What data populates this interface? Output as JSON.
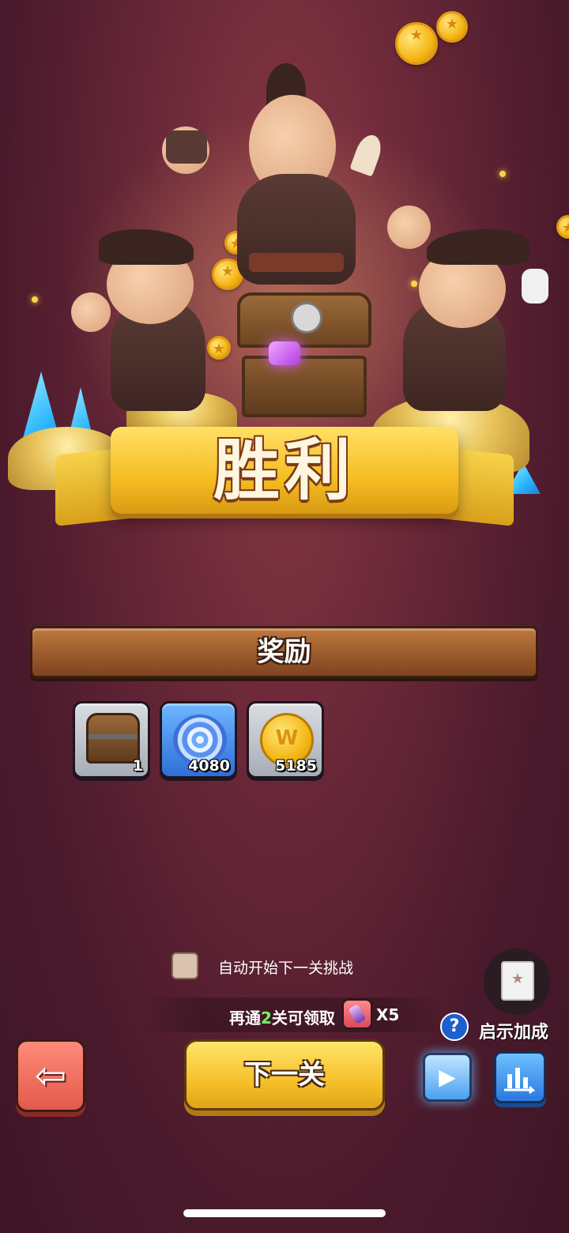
{
  "victory": {
    "title": "胜利"
  },
  "rewards": {
    "header": "奖励",
    "items": [
      {
        "icon": "treasure-chest-icon",
        "count": "1"
      },
      {
        "icon": "blue-gem-icon",
        "count": "4080"
      },
      {
        "icon": "gold-coin-icon",
        "count": "5185"
      }
    ]
  },
  "auto_next": {
    "label": "自动开始下一关挑战",
    "checked": false
  },
  "progress": {
    "prefix": "再通",
    "number": "2",
    "suffix": "关可领取",
    "multiplier": "X5"
  },
  "boost": {
    "label": "启示加成",
    "help": "?"
  },
  "buttons": {
    "back": "⇦",
    "next": "下一关",
    "play": "▶",
    "stats": "📊"
  },
  "colors": {
    "accent": "#f6c02a",
    "background": "#4a1a2c",
    "plank": "#9a5a2c",
    "highlight": "#6cff5a"
  }
}
